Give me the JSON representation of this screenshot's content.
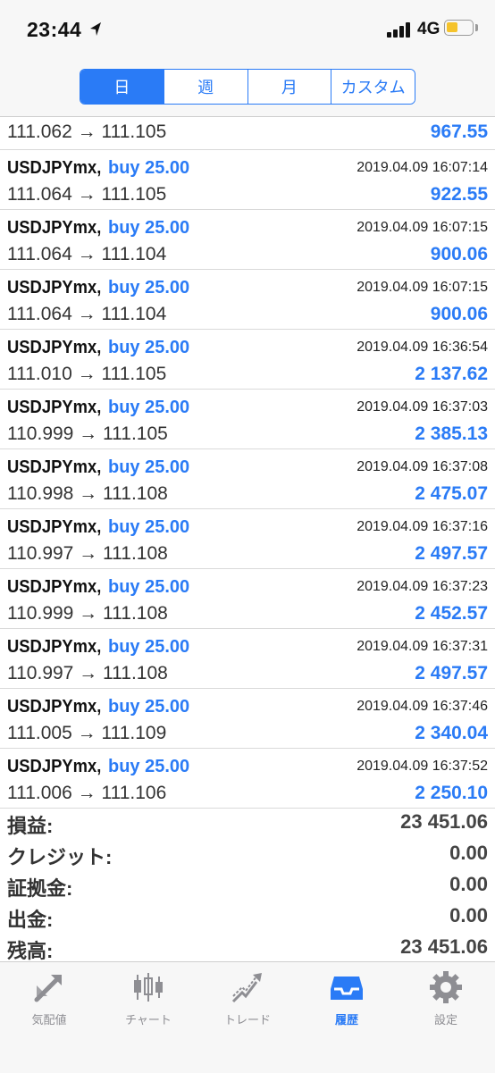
{
  "status": {
    "time": "23:44",
    "network": "4G"
  },
  "segments": [
    {
      "label": "日",
      "active": true
    },
    {
      "label": "週",
      "active": false
    },
    {
      "label": "月",
      "active": false
    },
    {
      "label": "カスタム",
      "active": false
    }
  ],
  "first_row": {
    "prices": "111.062 → 111.105",
    "profit": "967.55"
  },
  "deals": [
    {
      "symbol": "USDJPYmx,",
      "side": "buy 25.00",
      "time": "2019.04.09 16:07:14",
      "prices": "111.064 → 111.105",
      "profit": "922.55"
    },
    {
      "symbol": "USDJPYmx,",
      "side": "buy 25.00",
      "time": "2019.04.09 16:07:15",
      "prices": "111.064 → 111.104",
      "profit": "900.06"
    },
    {
      "symbol": "USDJPYmx,",
      "side": "buy 25.00",
      "time": "2019.04.09 16:07:15",
      "prices": "111.064 → 111.104",
      "profit": "900.06"
    },
    {
      "symbol": "USDJPYmx,",
      "side": "buy 25.00",
      "time": "2019.04.09 16:36:54",
      "prices": "111.010 → 111.105",
      "profit": "2 137.62"
    },
    {
      "symbol": "USDJPYmx,",
      "side": "buy 25.00",
      "time": "2019.04.09 16:37:03",
      "prices": "110.999 → 111.105",
      "profit": "2 385.13"
    },
    {
      "symbol": "USDJPYmx,",
      "side": "buy 25.00",
      "time": "2019.04.09 16:37:08",
      "prices": "110.998 → 111.108",
      "profit": "2 475.07"
    },
    {
      "symbol": "USDJPYmx,",
      "side": "buy 25.00",
      "time": "2019.04.09 16:37:16",
      "prices": "110.997 → 111.108",
      "profit": "2 497.57"
    },
    {
      "symbol": "USDJPYmx,",
      "side": "buy 25.00",
      "time": "2019.04.09 16:37:23",
      "prices": "110.999 → 111.108",
      "profit": "2 452.57"
    },
    {
      "symbol": "USDJPYmx,",
      "side": "buy 25.00",
      "time": "2019.04.09 16:37:31",
      "prices": "110.997 → 111.108",
      "profit": "2 497.57"
    },
    {
      "symbol": "USDJPYmx,",
      "side": "buy 25.00",
      "time": "2019.04.09 16:37:46",
      "prices": "111.005 → 111.109",
      "profit": "2 340.04"
    },
    {
      "symbol": "USDJPYmx,",
      "side": "buy 25.00",
      "time": "2019.04.09 16:37:52",
      "prices": "111.006 → 111.106",
      "profit": "2 250.10"
    }
  ],
  "summary": [
    {
      "label": "損益:",
      "value": "23 451.06"
    },
    {
      "label": "クレジット:",
      "value": "0.00"
    },
    {
      "label": "証拠金:",
      "value": "0.00"
    },
    {
      "label": "出金:",
      "value": "0.00"
    },
    {
      "label": "残高:",
      "value": "23 451.06"
    }
  ],
  "tabs": [
    {
      "label": "気配値",
      "icon": "quotes-icon",
      "active": false
    },
    {
      "label": "チャート",
      "icon": "chart-icon",
      "active": false
    },
    {
      "label": "トレード",
      "icon": "trade-icon",
      "active": false
    },
    {
      "label": "履歴",
      "icon": "history-icon",
      "active": true
    },
    {
      "label": "設定",
      "icon": "settings-icon",
      "active": false
    }
  ],
  "colors": {
    "accent": "#2a7bf6",
    "inactive": "#8e8e93",
    "battery": "#f5c32c"
  }
}
